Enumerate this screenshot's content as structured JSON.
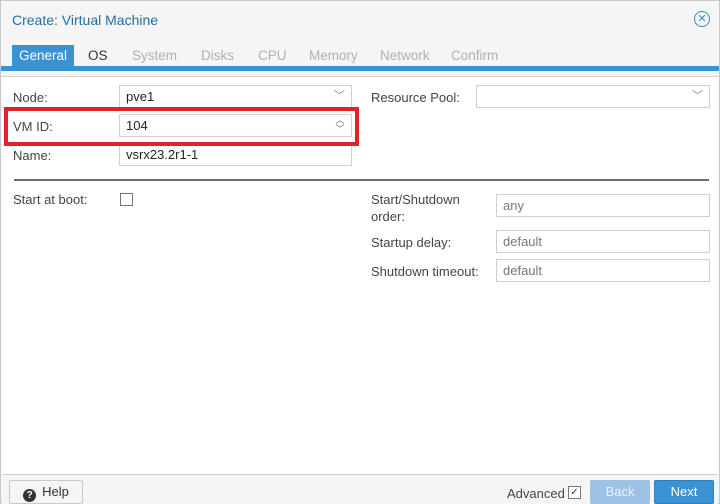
{
  "window": {
    "title": "Create: Virtual Machine",
    "close_icon": "close-circle-icon"
  },
  "tabs": [
    {
      "label": "General",
      "state": "active"
    },
    {
      "label": "OS",
      "state": "enabled"
    },
    {
      "label": "System",
      "state": "disabled"
    },
    {
      "label": "Disks",
      "state": "disabled"
    },
    {
      "label": "CPU",
      "state": "disabled"
    },
    {
      "label": "Memory",
      "state": "disabled"
    },
    {
      "label": "Network",
      "state": "disabled"
    },
    {
      "label": "Confirm",
      "state": "disabled"
    }
  ],
  "form": {
    "node": {
      "label": "Node:",
      "value": "pve1"
    },
    "vmid": {
      "label": "VM ID:",
      "value": "104"
    },
    "name": {
      "label": "Name:",
      "value": "vsrx23.2r1-1"
    },
    "resource_pool": {
      "label": "Resource Pool:",
      "value": ""
    },
    "start_at_boot": {
      "label": "Start at boot:",
      "checked": false
    },
    "start_shutdown_order": {
      "label_line1": "Start/Shutdown",
      "label_line2": "order:",
      "placeholder": "any"
    },
    "startup_delay": {
      "label": "Startup delay:",
      "placeholder": "default"
    },
    "shutdown_timeout": {
      "label": "Shutdown timeout:",
      "placeholder": "default"
    }
  },
  "footer": {
    "help_label": "Help",
    "advanced_label": "Advanced",
    "advanced_checked": true,
    "back_label": "Back",
    "next_label": "Next"
  },
  "colors": {
    "accent": "#3892d4",
    "highlight": "#e3202b",
    "title": "#1d6fa8"
  }
}
